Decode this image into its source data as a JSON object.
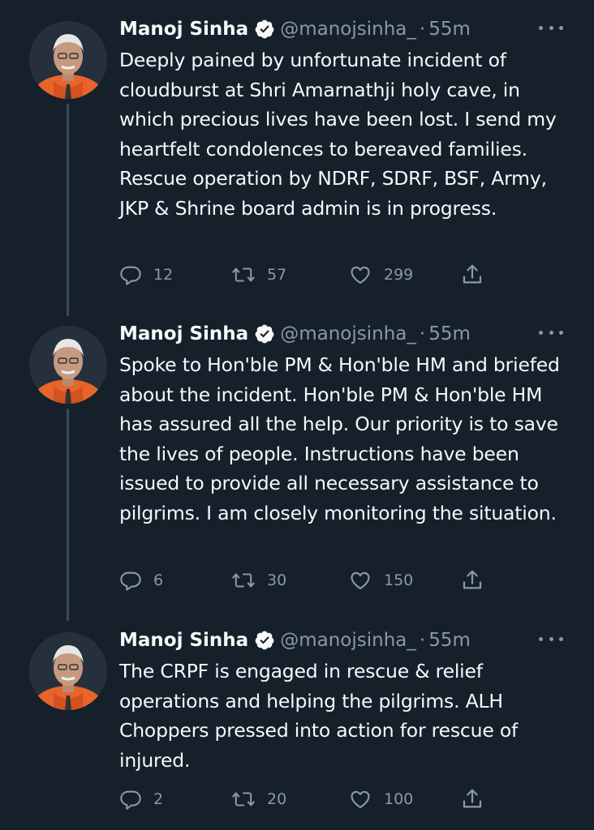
{
  "tweets": [
    {
      "name": "Manoj Sinha",
      "handle": "@manojsinha_",
      "separator": "·",
      "time": "55m",
      "text": "Deeply pained by unfortunate incident of cloudburst at Shri Amarnathji holy cave, in which precious lives have been lost. I send my heartfelt condolences to bereaved families. Rescue operation by NDRF, SDRF, BSF, Army, JKP & Shrine board admin is in progress.",
      "replies": "12",
      "retweets": "57",
      "likes": "299"
    },
    {
      "name": "Manoj Sinha",
      "handle": "@manojsinha_",
      "separator": "·",
      "time": "55m",
      "text": "Spoke to Hon'ble PM & Hon'ble HM and briefed about the incident. Hon'ble PM & Hon'ble HM has assured all the help. Our priority is to save the lives of people. Instructions have been issued to provide all necessary assistance to pilgrims. I am closely monitoring the situation.",
      "replies": "6",
      "retweets": "30",
      "likes": "150"
    },
    {
      "name": "Manoj Sinha",
      "handle": "@manojsinha_",
      "separator": "·",
      "time": "55m",
      "text": "The CRPF is engaged in rescue & relief operations and helping the pilgrims. ALH Choppers pressed into action for rescue of injured.",
      "replies": "2",
      "retweets": "20",
      "likes": "100"
    }
  ],
  "icons": {
    "verified": "verified-badge-icon",
    "more": "more-options-icon",
    "reply": "reply-icon",
    "retweet": "retweet-icon",
    "like": "like-heart-icon",
    "share": "share-icon"
  },
  "colors": {
    "background": "#15202b",
    "text": "#f7f9f9",
    "secondary_text": "#8b98a5",
    "thread_line": "#3d4a58",
    "verified_badge": "#f7f9f9"
  }
}
